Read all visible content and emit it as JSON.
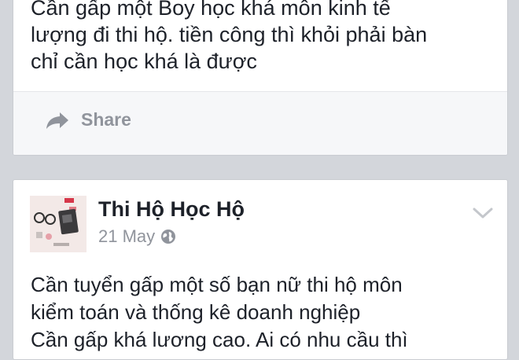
{
  "feed": {
    "post1": {
      "text_lines": [
        "Cần gấp một Boy học khá môn kinh tế",
        "lượng đi thi hộ. tiền công thì khỏi phải bàn",
        "chỉ cần học khá là được"
      ],
      "share_label": "Share",
      "share_icon": "share-arrow-icon"
    },
    "post2": {
      "page_name": "Thi Hộ Học Hộ",
      "date": "21 May",
      "privacy_icon": "globe-icon",
      "menu_icon": "chevron-down-icon",
      "text_lines": [
        "Cần tuyển gấp một số bạn nữ thi hộ môn",
        "kiểm toán và thống kê doanh nghiệp",
        "Cần gấp khá lương cao. Ai có nhu cầu thì"
      ]
    }
  },
  "colors": {
    "background": "#d3d6db",
    "card": "#ffffff",
    "text_primary": "#1d2129",
    "text_secondary": "#90949c"
  }
}
